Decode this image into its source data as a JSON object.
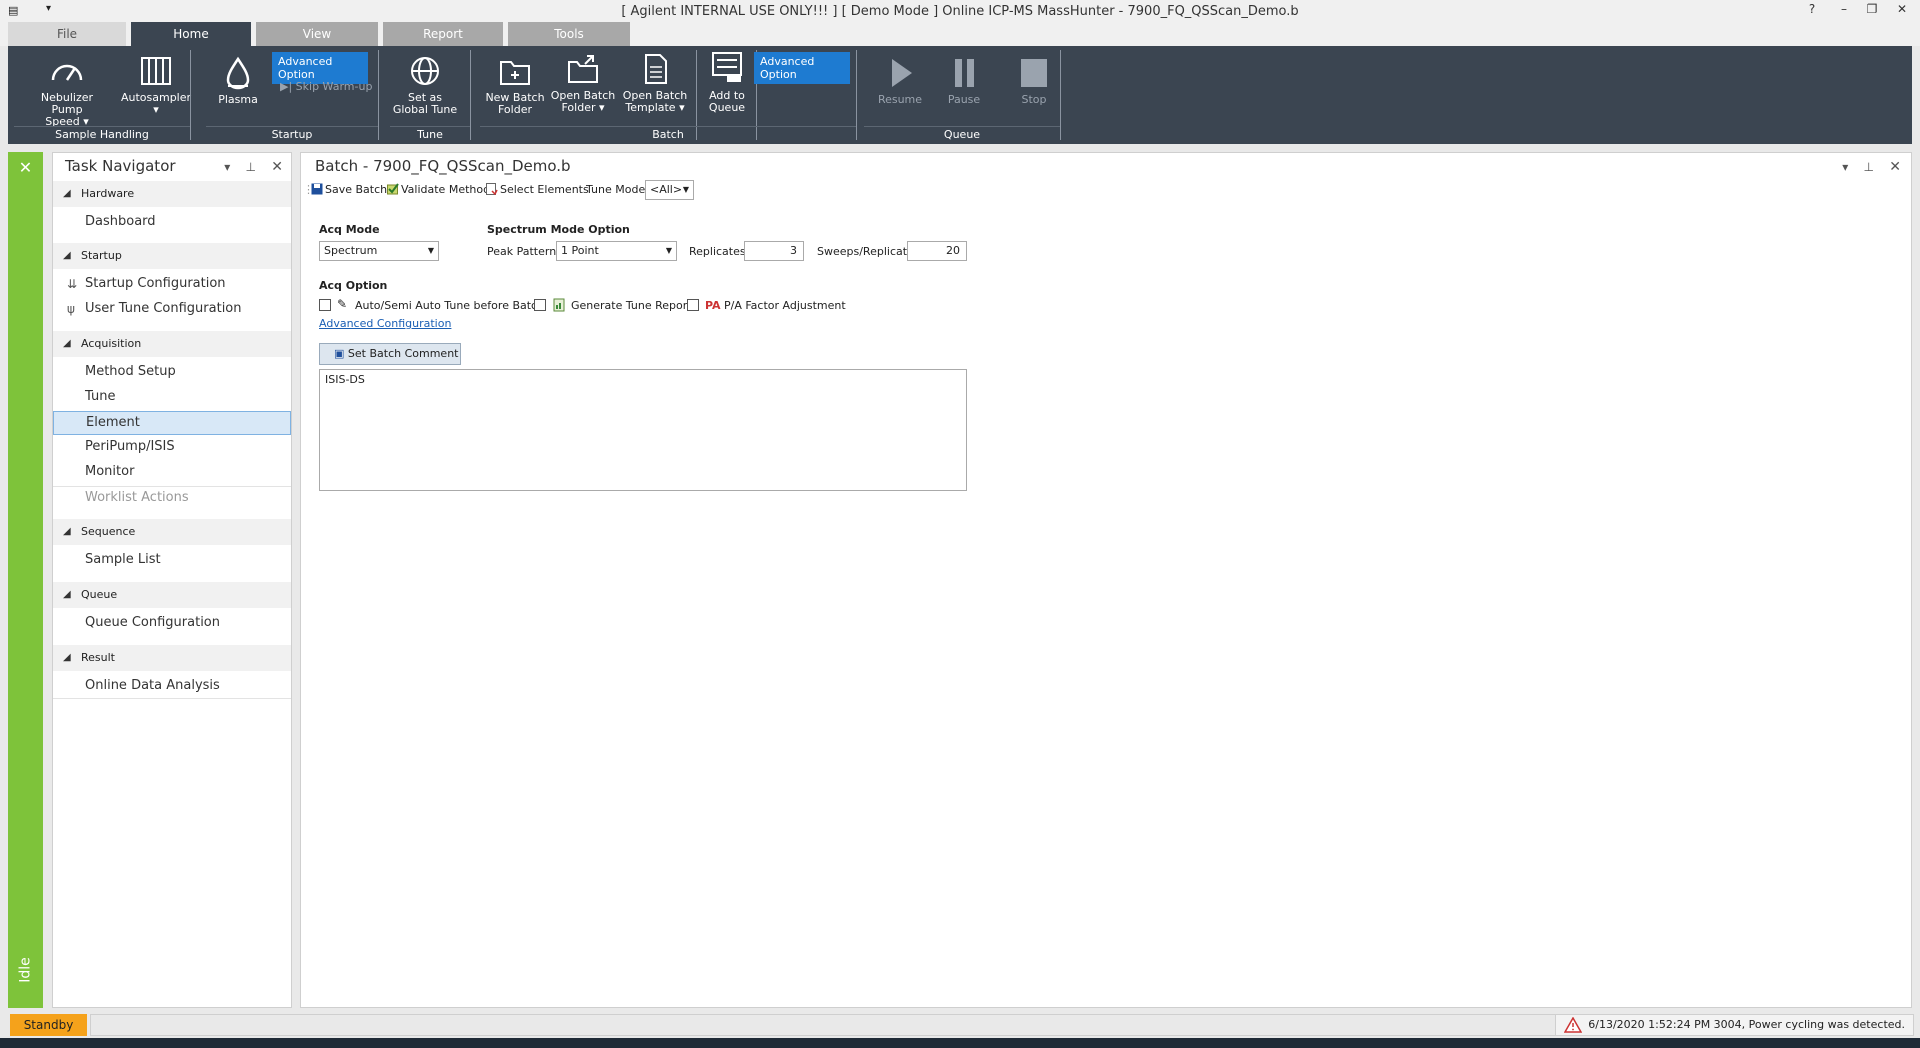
{
  "window": {
    "title": "[ Agilent INTERNAL USE ONLY!!! ] [ Demo Mode ] Online ICP-MS MassHunter - 7900_FQ_QSScan_Demo.b",
    "help": "?",
    "minimize": "–",
    "restore": "❐",
    "close": "✕"
  },
  "tabs": [
    {
      "label": "File"
    },
    {
      "label": "Home"
    },
    {
      "label": "View"
    },
    {
      "label": "Report"
    },
    {
      "label": "Tools"
    }
  ],
  "ribbon": {
    "nebulizer_line1": "Nebulizer Pump",
    "nebulizer_line2": "Speed",
    "autosampler": "Autosampler",
    "plasma": "Plasma",
    "advanced_option_1": "Advanced Option",
    "skip_warmup": "Skip Warm-up",
    "set_global_tune_line1": "Set as",
    "set_global_tune_line2": "Global Tune",
    "new_batch_line1": "New Batch",
    "new_batch_line2": "Folder",
    "open_batch_line1": "Open Batch",
    "open_batch_line2": "Folder",
    "open_template_line1": "Open Batch",
    "open_template_line2": "Template",
    "add_queue_line1": "Add to",
    "add_queue_line2": "Queue",
    "advanced_option_2": "Advanced Option",
    "resume": "Resume",
    "pause": "Pause",
    "stop": "Stop",
    "groups": {
      "sample_handling": "Sample Handling",
      "startup": "Startup",
      "tune": "Tune",
      "batch": "Batch",
      "queue": "Queue"
    }
  },
  "leftstrip": {
    "status": "Idle",
    "color": "#7ec33a"
  },
  "navigator": {
    "title": "Task Navigator",
    "sections": [
      {
        "label": "Hardware",
        "items": [
          "Dashboard"
        ]
      },
      {
        "label": "Startup",
        "items": [
          "Startup Configuration",
          "User Tune Configuration"
        ]
      },
      {
        "label": "Acquisition",
        "items": [
          "Method Setup",
          "Tune",
          "Element",
          "PeriPump/ISIS",
          "Monitor",
          "Worklist Actions"
        ]
      },
      {
        "label": "Sequence",
        "items": [
          "Sample List"
        ]
      },
      {
        "label": "Queue",
        "items": [
          "Queue Configuration"
        ]
      },
      {
        "label": "Result",
        "items": [
          "Online Data Analysis"
        ]
      }
    ],
    "selected": "Element"
  },
  "main": {
    "title": "Batch - 7900_FQ_QSScan_Demo.b",
    "toolbar": {
      "save": "Save Batch",
      "validate": "Validate Method",
      "select_elements": "Select Elements",
      "tune_mode_label": "Tune Mode:",
      "tune_mode_value": "<All>"
    },
    "acq_mode_label": "Acq Mode",
    "acq_mode_value": "Spectrum",
    "spectrum_option_label": "Spectrum Mode Option",
    "peak_pattern_label": "Peak Pattern:",
    "peak_pattern_value": "1 Point",
    "replicates_label": "Replicates:",
    "replicates_value": "3",
    "sweeps_label": "Sweeps/Replicate",
    "sweeps_value": "20",
    "acq_option_label": "Acq Option",
    "auto_tune": "Auto/Semi Auto Tune before Batch",
    "tune_report": "Generate Tune Report",
    "pa_factor": "P/A Factor Adjustment",
    "advanced_config": "Advanced Configuration",
    "set_batch_comment": "Set Batch Comment",
    "comment_text": "ISIS-DS"
  },
  "status": {
    "standby": "Standby",
    "standby_color": "#f5a21b",
    "message": "6/13/2020 1:52:24 PM 3004, Power cycling was detected."
  }
}
